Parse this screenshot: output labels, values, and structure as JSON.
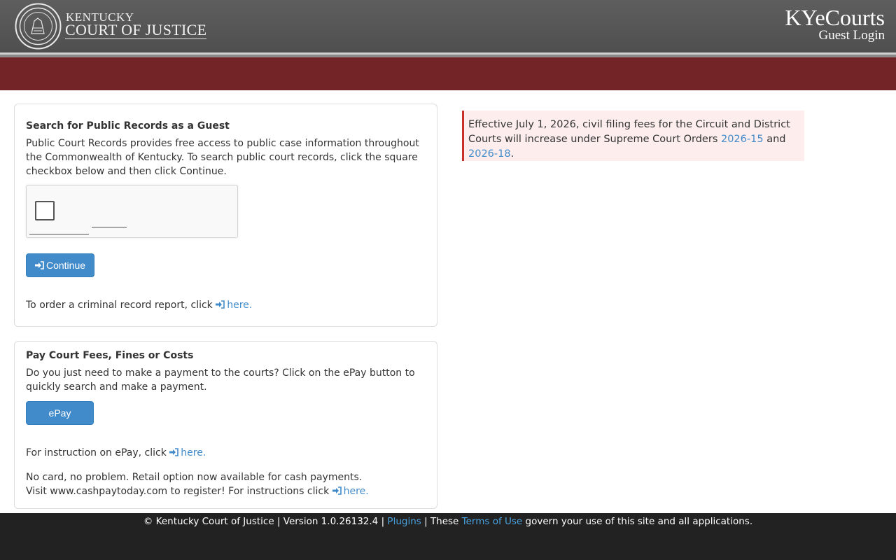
{
  "header": {
    "org_line1": "KENTUCKY",
    "org_line2": "COURT OF JUSTICE",
    "app_title": "KYeCourts",
    "app_subtitle": "Guest Login",
    "seal_icon": "seal-icon"
  },
  "search_panel": {
    "title": "Search for Public Records as a Guest",
    "description": "Public Court Records provides free access to public case information throughout the Commonwealth of Kentucky. To search public court records, click the square checkbox below and then click Continue.",
    "continue_label": "Continue",
    "criminal_text": "To order a criminal record report, click",
    "criminal_link": "here."
  },
  "pay_panel": {
    "title": "Pay Court Fees, Fines or Costs",
    "description": "Do you just need to make a payment to the courts? Click on the ePay button to quickly search and make a payment.",
    "epay_label": "ePay",
    "instruction_text": "For instruction on ePay, click",
    "instruction_link": "here.",
    "cash_text": "No card, no problem. Retail option now available for cash payments. Visit www.cashpaytoday.com to register! For instructions click",
    "cash_link": "here."
  },
  "alert": {
    "text_before": "Effective July 1, 2026, civil filing fees for the Circuit and District Courts will increase under Supreme Court Orders",
    "link1": "2026-15",
    "and": "and",
    "link2": "2026-18",
    "period": "."
  },
  "footer": {
    "copyright": "© Kentucky Court of Justice | Version 1.0.26132.4 |",
    "plugins_link": "Plugins",
    "sep": "| These",
    "terms_link": "Terms of Use",
    "tail": "govern your use of this site and all applications."
  },
  "colors": {
    "header": "#575757",
    "redbar": "#722427",
    "button": "#428bca",
    "alert_bg": "#fdeded",
    "alert_border": "#c9302c",
    "footer": "#222222"
  }
}
